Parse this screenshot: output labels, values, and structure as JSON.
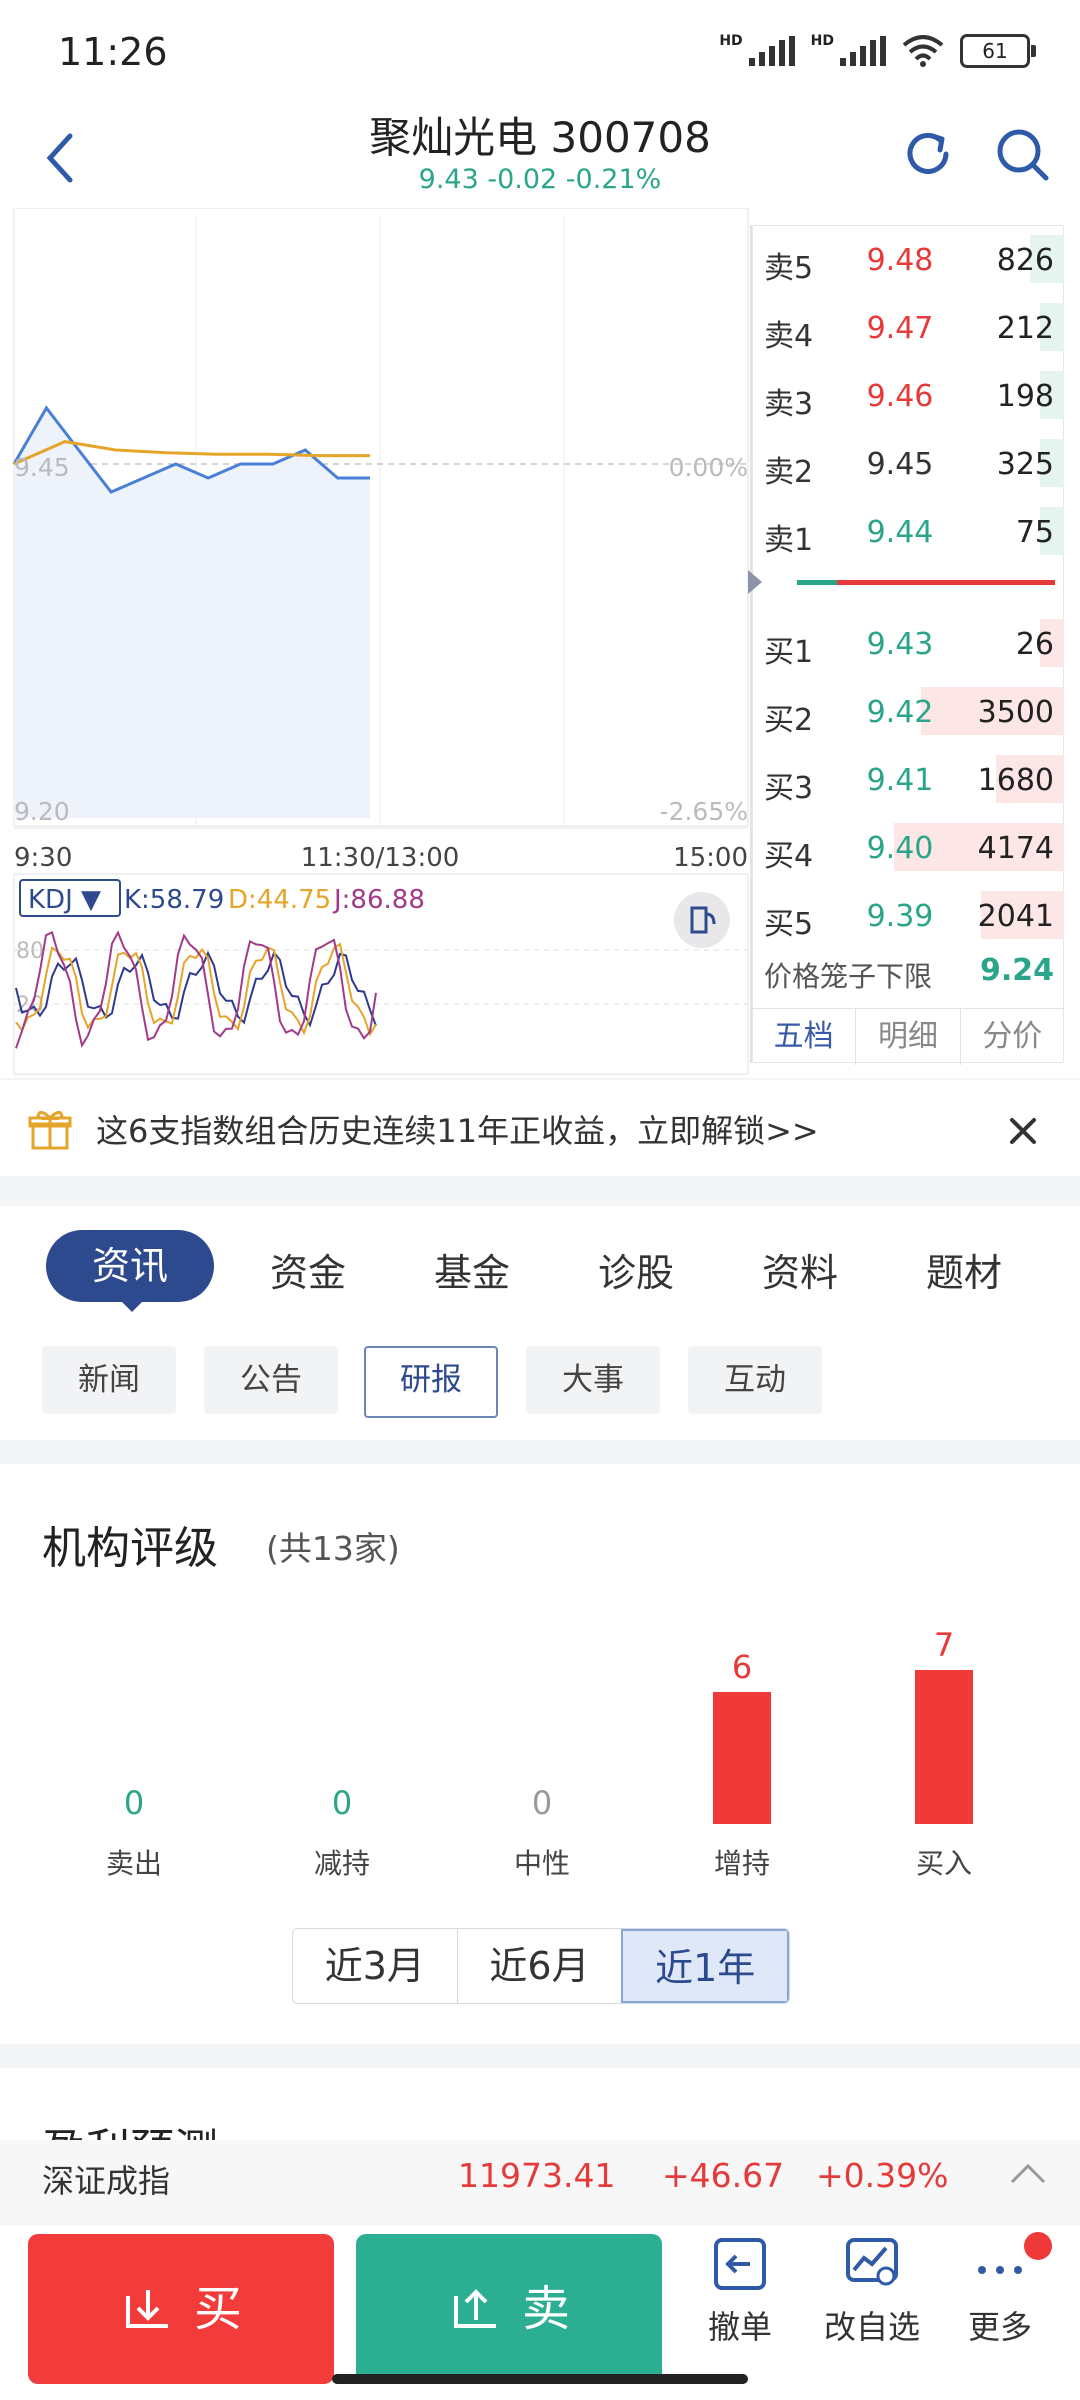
{
  "status": {
    "time": "11:26",
    "battery": "61",
    "hd1": "HD",
    "hd2": "HD"
  },
  "header": {
    "title": "聚灿光电 300708",
    "quote": "9.43 -0.02 -0.21%"
  },
  "chart": {
    "price_top_label": "9.45",
    "pct_top_label": "0.00%",
    "price_bottom_label": "9.20",
    "pct_bottom_label": "-2.65%",
    "time_labels": [
      "9:30",
      "11:30/13:00",
      "15:00"
    ],
    "kdj": {
      "name": "KDJ ▼",
      "k": "K:58.79",
      "d": "D:44.75",
      "j": "J:86.88",
      "axis80": "80",
      "axis20": "20"
    }
  },
  "orderbook": {
    "asks": [
      {
        "label": "卖5",
        "price": "9.48",
        "vol": "826",
        "color": "red"
      },
      {
        "label": "卖4",
        "price": "9.47",
        "vol": "212",
        "color": "red"
      },
      {
        "label": "卖3",
        "price": "9.46",
        "vol": "198",
        "color": "red"
      },
      {
        "label": "卖2",
        "price": "9.45",
        "vol": "325",
        "color": "gray"
      },
      {
        "label": "卖1",
        "price": "9.44",
        "vol": "75",
        "color": "green"
      }
    ],
    "bids": [
      {
        "label": "买1",
        "price": "9.43",
        "vol": "26",
        "color": "green"
      },
      {
        "label": "买2",
        "price": "9.42",
        "vol": "3500",
        "color": "green"
      },
      {
        "label": "买3",
        "price": "9.41",
        "vol": "1680",
        "color": "green"
      },
      {
        "label": "买4",
        "price": "9.40",
        "vol": "4174",
        "color": "green"
      },
      {
        "label": "买5",
        "price": "9.39",
        "vol": "2041",
        "color": "green"
      }
    ],
    "limit_label": "价格笼子下限",
    "limit_value": "9.24",
    "tabs": [
      "五档",
      "明细",
      "分价"
    ]
  },
  "banner": {
    "text": "这6支指数组合历史连续11年正收益，立即解锁>>"
  },
  "content_tabs": [
    "资讯",
    "资金",
    "基金",
    "诊股",
    "资料",
    "题材"
  ],
  "sub_tabs": [
    "新闻",
    "公告",
    "研报",
    "大事",
    "互动"
  ],
  "rating": {
    "title": "机构评级",
    "count": "(共13家)",
    "items": [
      {
        "label": "卖出",
        "value": 0
      },
      {
        "label": "减持",
        "value": 0
      },
      {
        "label": "中性",
        "value": 0
      },
      {
        "label": "增持",
        "value": 6
      },
      {
        "label": "买入",
        "value": 7
      }
    ],
    "periods": [
      "近3月",
      "近6月",
      "近1年"
    ]
  },
  "profit_title": "盈利预测",
  "index_bar": {
    "name": "深证成指",
    "value": "11973.41",
    "change": "+46.67",
    "pct": "+0.39%"
  },
  "bottom": {
    "buy": "买",
    "sell": "卖",
    "cancel": "撤单",
    "watchlist": "改自选",
    "more": "更多"
  },
  "colors": {
    "up": "#e63a3a",
    "down": "#2ba58a",
    "accent": "#2e4a8e",
    "price_line": "#4a7fd8",
    "avg_line": "#e5a42a"
  },
  "chart_data": {
    "type": "line",
    "x": [
      "9:30",
      "11:30/13:00",
      "15:00"
    ],
    "series": [
      {
        "values": [
          9.45,
          9.49,
          9.46,
          9.43,
          9.44,
          9.45,
          9.44,
          9.45,
          9.45,
          9.46,
          9.44,
          9.44
        ]
      },
      {
        "values": [
          9.45,
          9.466,
          9.46,
          9.458,
          9.457,
          9.457,
          9.456,
          9.456
        ]
      }
    ],
    "ylim": [
      9.2,
      9.45
    ]
  }
}
